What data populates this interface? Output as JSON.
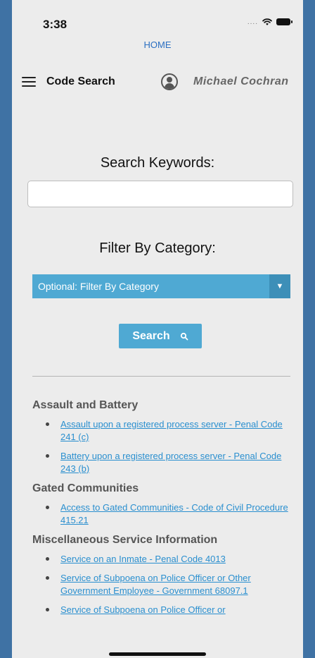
{
  "status_bar": {
    "time": "3:38",
    "signal": "...."
  },
  "nav": {
    "home_link": "HOME",
    "title": "Code Search",
    "user_name": "Michael Cochran"
  },
  "search": {
    "label": "Search Keywords:",
    "input_value": "",
    "placeholder": "",
    "filter_label": "Filter By Category:",
    "filter_selected": "Optional: Filter By Category",
    "filter_arrow": "▼",
    "button_label": "Search"
  },
  "results": [
    {
      "category": "Assault and Battery",
      "items": [
        "Assault upon a registered process server - Penal Code 241 (c)",
        "Battery upon a registered process server - Penal Code 243 (b)"
      ]
    },
    {
      "category": "Gated Communities",
      "items": [
        "Access to Gated Communities - Code of Civil Procedure 415.21"
      ]
    },
    {
      "category": "Miscellaneous Service Information",
      "items": [
        "Service on an Inmate - Penal Code 4013",
        "Service of Subpoena on Police Officer or Other Government Employee - Government 68097.1",
        "Service of Subpoena on Police Officer or"
      ]
    }
  ],
  "colors": {
    "frame": "#3f72a4",
    "background": "#ececec",
    "accent": "#4fa9d3",
    "link": "#2a8fcf",
    "home_link": "#2b6fc2"
  }
}
